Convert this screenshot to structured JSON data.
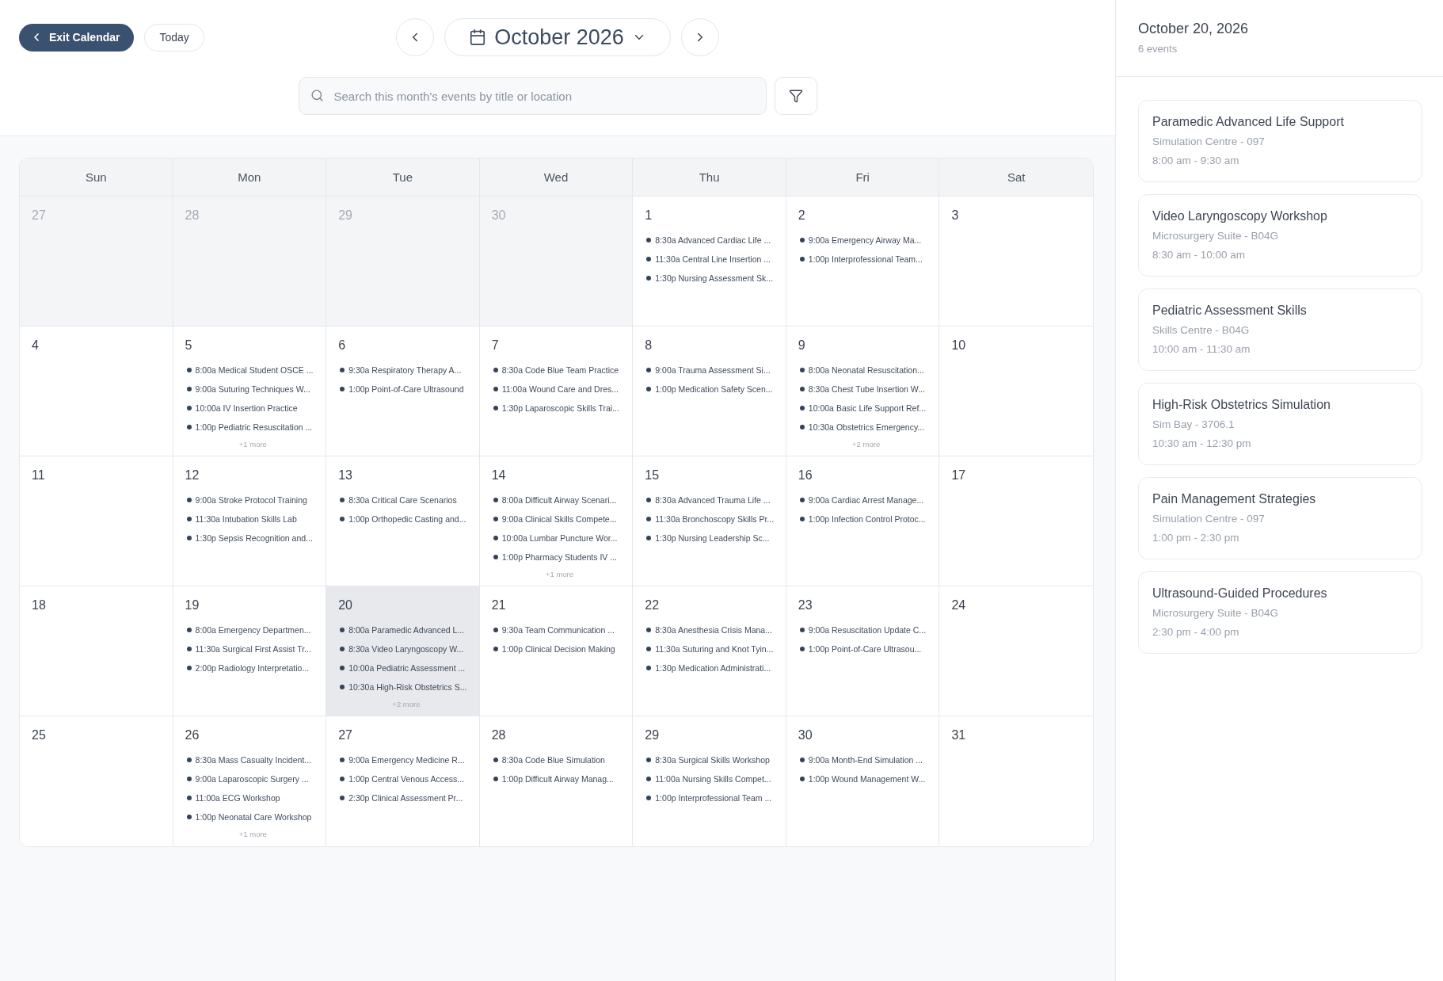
{
  "toolbar": {
    "exit_button": "Exit Calendar",
    "today_button": "Today",
    "month": "October 2026"
  },
  "search": {
    "placeholder": "Search this month's events by title or location"
  },
  "calendar": {
    "weekdays": [
      "Sun",
      "Mon",
      "Tue",
      "Wed",
      "Thu",
      "Fri",
      "Sat"
    ],
    "weeks": [
      {
        "days": [
          {
            "day": "27",
            "outside_month": true,
            "selected": false
          },
          {
            "day": "28",
            "outside_month": true,
            "selected": false
          },
          {
            "day": "29",
            "outside_month": true,
            "selected": false
          },
          {
            "day": "30",
            "outside_month": true,
            "selected": false
          },
          {
            "day": "1",
            "outside_month": false,
            "selected": false,
            "events": [
              "8:30a Advanced Cardiac Life ...",
              "11:30a Central Line Insertion ...",
              "1:30p Nursing Assessment Sk..."
            ]
          },
          {
            "day": "2",
            "outside_month": false,
            "selected": false,
            "events": [
              "9:00a Emergency Airway Ma...",
              "1:00p Interprofessional Team..."
            ]
          },
          {
            "day": "3",
            "outside_month": false,
            "selected": false
          }
        ]
      },
      {
        "days": [
          {
            "day": "4",
            "outside_month": false,
            "selected": false
          },
          {
            "day": "5",
            "outside_month": false,
            "selected": false,
            "events": [
              "8:00a Medical Student OSCE ...",
              "9:00a Suturing Techniques W...",
              "10:00a IV Insertion Practice",
              "1:00p Pediatric Resuscitation ..."
            ],
            "more": "+1 more"
          },
          {
            "day": "6",
            "outside_month": false,
            "selected": false,
            "events": [
              "9:30a Respiratory Therapy A...",
              "1:00p Point-of-Care Ultrasound"
            ]
          },
          {
            "day": "7",
            "outside_month": false,
            "selected": false,
            "events": [
              "8:30a Code Blue Team Practice",
              "11:00a Wound Care and Dres...",
              "1:30p Laparoscopic Skills Trai..."
            ]
          },
          {
            "day": "8",
            "outside_month": false,
            "selected": false,
            "events": [
              "9:00a Trauma Assessment Si...",
              "1:00p Medication Safety Scen..."
            ]
          },
          {
            "day": "9",
            "outside_month": false,
            "selected": false,
            "events": [
              "8:00a Neonatal Resuscitation...",
              "8:30a Chest Tube Insertion W...",
              "10:00a Basic Life Support Ref...",
              "10:30a Obstetrics Emergency..."
            ],
            "more": "+2 more"
          },
          {
            "day": "10",
            "outside_month": false,
            "selected": false
          }
        ]
      },
      {
        "days": [
          {
            "day": "11",
            "outside_month": false,
            "selected": false
          },
          {
            "day": "12",
            "outside_month": false,
            "selected": false,
            "events": [
              "9:00a Stroke Protocol Training",
              "11:30a Intubation Skills Lab",
              "1:30p Sepsis Recognition and..."
            ]
          },
          {
            "day": "13",
            "outside_month": false,
            "selected": false,
            "events": [
              "8:30a Critical Care Scenarios",
              "1:00p Orthopedic Casting and..."
            ]
          },
          {
            "day": "14",
            "outside_month": false,
            "selected": false,
            "events": [
              "8:00a Difficult Airway Scenari...",
              "9:00a Clinical Skills Compete...",
              "10:00a Lumbar Puncture Wor...",
              "1:00p Pharmacy Students IV ..."
            ],
            "more": "+1 more"
          },
          {
            "day": "15",
            "outside_month": false,
            "selected": false,
            "events": [
              "8:30a Advanced Trauma Life ...",
              "11:30a Bronchoscopy Skills Pr...",
              "1:30p Nursing Leadership Sc..."
            ]
          },
          {
            "day": "16",
            "outside_month": false,
            "selected": false,
            "events": [
              "9:00a Cardiac Arrest Manage...",
              "1:00p Infection Control Protoc..."
            ]
          },
          {
            "day": "17",
            "outside_month": false,
            "selected": false
          }
        ]
      },
      {
        "days": [
          {
            "day": "18",
            "outside_month": false,
            "selected": false
          },
          {
            "day": "19",
            "outside_month": false,
            "selected": false,
            "events": [
              "8:00a Emergency Departmen...",
              "11:30a Surgical First Assist Tr...",
              "2:00p Radiology Interpretatio..."
            ]
          },
          {
            "day": "20",
            "outside_month": false,
            "selected": true,
            "events": [
              "8:00a Paramedic Advanced L...",
              "8:30a Video Laryngoscopy W...",
              "10:00a Pediatric Assessment ...",
              "10:30a High-Risk Obstetrics S..."
            ],
            "more": "+2 more"
          },
          {
            "day": "21",
            "outside_month": false,
            "selected": false,
            "events": [
              "9:30a Team Communication ...",
              "1:00p Clinical Decision Making"
            ]
          },
          {
            "day": "22",
            "outside_month": false,
            "selected": false,
            "events": [
              "8:30a Anesthesia Crisis Mana...",
              "11:30a Suturing and Knot Tyin...",
              "1:30p Medication Administrati..."
            ]
          },
          {
            "day": "23",
            "outside_month": false,
            "selected": false,
            "events": [
              "9:00a Resuscitation Update C...",
              "1:00p Point-of-Care Ultrasou..."
            ]
          },
          {
            "day": "24",
            "outside_month": false,
            "selected": false
          }
        ]
      },
      {
        "days": [
          {
            "day": "25",
            "outside_month": false,
            "selected": false
          },
          {
            "day": "26",
            "outside_month": false,
            "selected": false,
            "events": [
              "8:30a Mass Casualty Incident...",
              "9:00a Laparoscopic Surgery ...",
              "11:00a ECG Workshop",
              "1:00p Neonatal Care Workshop"
            ],
            "more": "+1 more"
          },
          {
            "day": "27",
            "outside_month": false,
            "selected": false,
            "events": [
              "9:00a Emergency Medicine R...",
              "1:00p Central Venous Access...",
              "2:30p Clinical Assessment Pr..."
            ]
          },
          {
            "day": "28",
            "outside_month": false,
            "selected": false,
            "events": [
              "8:30a Code Blue Simulation",
              "1:00p Difficult Airway Manag..."
            ]
          },
          {
            "day": "29",
            "outside_month": false,
            "selected": false,
            "events": [
              "8:30a Surgical Skills Workshop",
              "11:00a Nursing Skills Compet...",
              "1:00p Interprofessional Team ..."
            ]
          },
          {
            "day": "30",
            "outside_month": false,
            "selected": false,
            "events": [
              "9:00a Month-End Simulation ...",
              "1:00p Wound Management W..."
            ]
          },
          {
            "day": "31",
            "outside_month": false,
            "selected": false
          }
        ]
      }
    ]
  },
  "day_panel": {
    "title": "October 20, 2026",
    "count": "6 events",
    "events": [
      {
        "title": "Paramedic Advanced Life Support",
        "location": "Simulation Centre - 097",
        "time": "8:00 am - 9:30 am"
      },
      {
        "title": "Video Laryngoscopy Workshop",
        "location": "Microsurgery Suite - B04G",
        "time": "8:30 am - 10:00 am"
      },
      {
        "title": "Pediatric Assessment Skills",
        "location": "Skills Centre - B04G",
        "time": "10:00 am - 11:30 am"
      },
      {
        "title": "High-Risk Obstetrics Simulation",
        "location": "Sim Bay - 3706.1",
        "time": "10:30 am - 12:30 pm"
      },
      {
        "title": "Pain Management Strategies",
        "location": "Simulation Centre - 097",
        "time": "1:00 pm - 2:30 pm"
      },
      {
        "title": "Ultrasound-Guided Procedures",
        "location": "Microsurgery Suite - B04G",
        "time": "2:30 pm - 4:00 pm"
      }
    ]
  }
}
